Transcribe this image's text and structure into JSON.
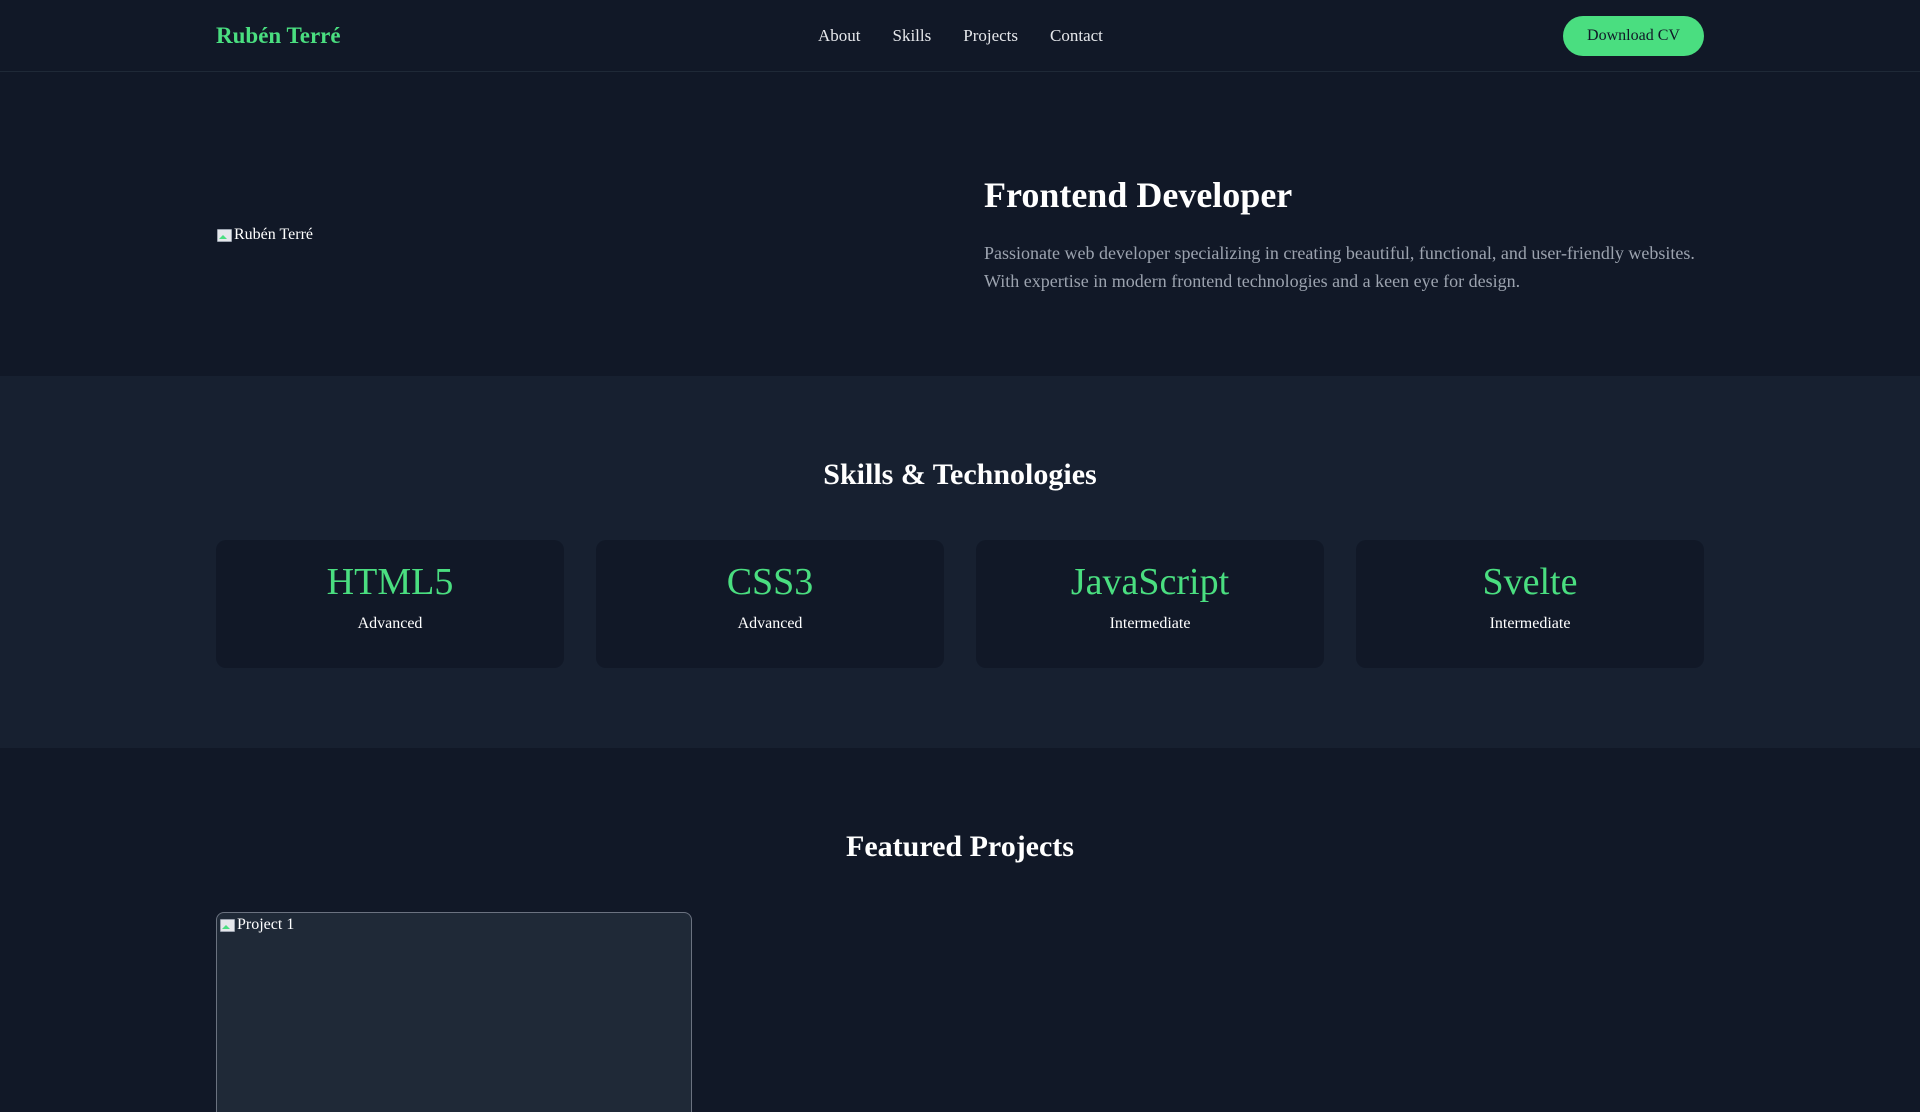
{
  "header": {
    "brand": "Rubén Terré",
    "nav": [
      "About",
      "Skills",
      "Projects",
      "Contact"
    ],
    "cv_button": "Download CV"
  },
  "hero": {
    "image_alt": "Rubén Terré",
    "title": "Frontend Developer",
    "description": "Passionate web developer specializing in creating beautiful, functional, and user-friendly websites. With expertise in modern frontend technologies and a keen eye for design."
  },
  "skills": {
    "title": "Skills & Technologies",
    "items": [
      {
        "name": "HTML5",
        "level": "Advanced"
      },
      {
        "name": "CSS3",
        "level": "Advanced"
      },
      {
        "name": "JavaScript",
        "level": "Intermediate"
      },
      {
        "name": "Svelte",
        "level": "Intermediate"
      }
    ]
  },
  "projects": {
    "title": "Featured Projects",
    "items": [
      {
        "image_alt": "Project 1"
      }
    ]
  },
  "colors": {
    "accent": "#4ade80",
    "background": "#111827",
    "section_alt": "#172030",
    "card": "#1f2937",
    "muted_text": "#9ca3af"
  },
  "icons": {
    "broken_image": "broken-image-icon"
  }
}
